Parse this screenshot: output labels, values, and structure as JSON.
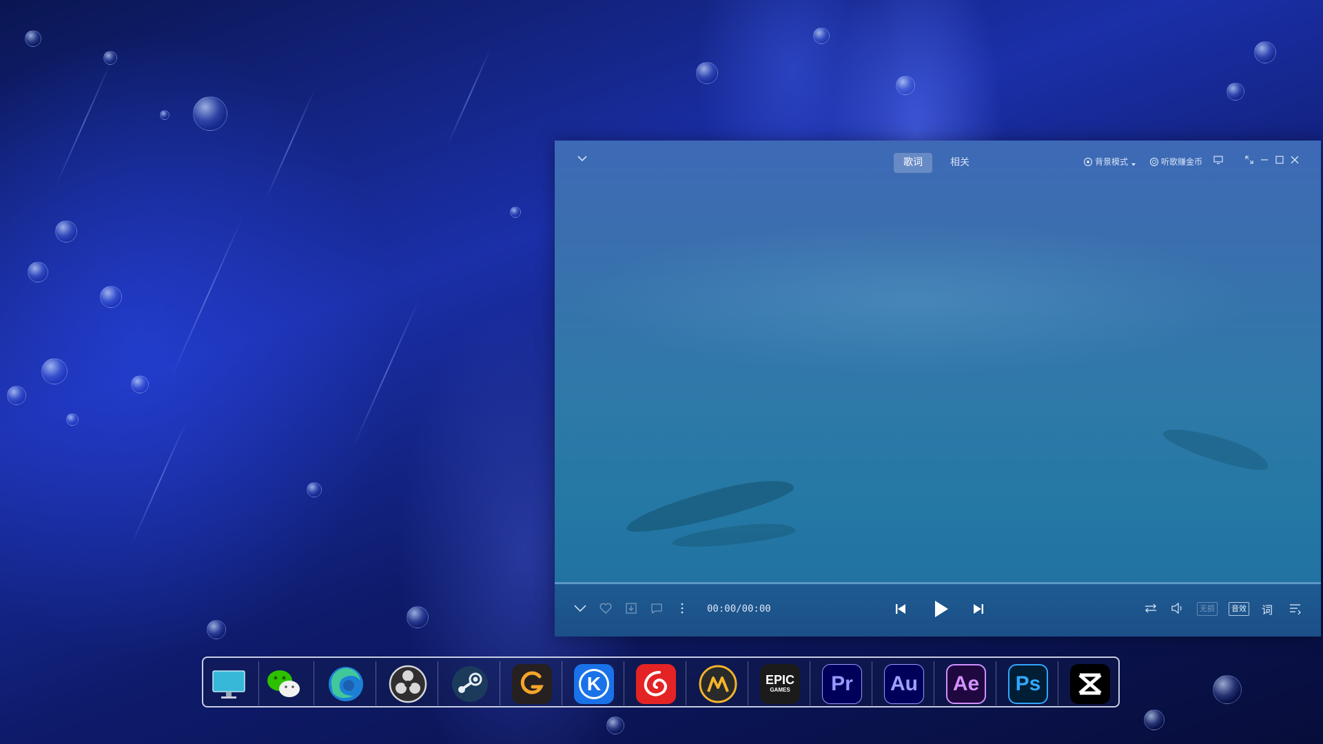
{
  "player": {
    "tabs": [
      {
        "label": "歌词",
        "active": true
      },
      {
        "label": "相关",
        "active": false
      }
    ],
    "bg_mode_label": "背景模式",
    "earn_coins_label": "听歌赚金币",
    "time_display": "00:00/00:00",
    "lossless_label": "无损",
    "effect_label": "音效",
    "lyrics_toggle_label": "词",
    "progress_fraction": 0,
    "colors": {
      "accent": "#3e69b6",
      "bar": "#1f5a92"
    }
  },
  "dock": {
    "apps": [
      {
        "name": "desktop",
        "icon": "monitor-icon"
      },
      {
        "name": "wechat",
        "icon": "wechat-icon"
      },
      {
        "name": "edge",
        "icon": "edge-icon"
      },
      {
        "name": "obs",
        "icon": "obs-icon"
      },
      {
        "name": "steam",
        "icon": "steam-icon"
      },
      {
        "name": "bandicam",
        "icon": "g-icon"
      },
      {
        "name": "kugou",
        "icon": "kugou-icon",
        "text": "K"
      },
      {
        "name": "netease-music",
        "icon": "netease-icon"
      },
      {
        "name": "mango",
        "icon": "mango-icon"
      },
      {
        "name": "epic-games",
        "icon": "epic-icon",
        "text": "EPIC",
        "subtext": "GAMES"
      },
      {
        "name": "premiere",
        "icon": "premiere-icon",
        "text": "Pr"
      },
      {
        "name": "audition",
        "icon": "audition-icon",
        "text": "Au"
      },
      {
        "name": "after-effects",
        "icon": "after-effects-icon",
        "text": "Ae"
      },
      {
        "name": "photoshop",
        "icon": "photoshop-icon",
        "text": "Ps"
      },
      {
        "name": "capcut",
        "icon": "capcut-icon"
      }
    ]
  }
}
